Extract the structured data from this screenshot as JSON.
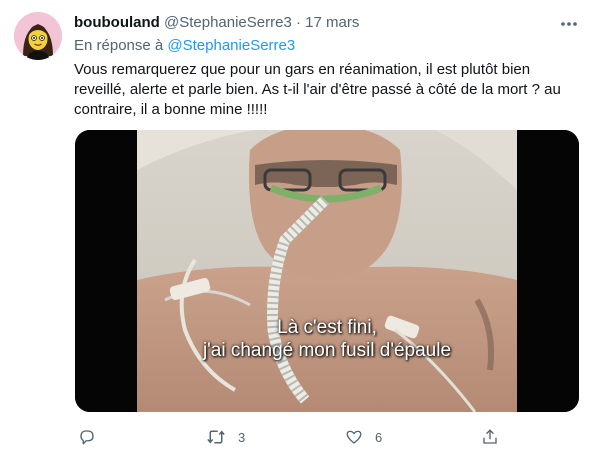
{
  "tweet": {
    "display_name": "boubouland",
    "handle": "@StephanieSerre3",
    "separator": "·",
    "date": "17 mars",
    "more_icon": "more-horizontal-icon",
    "reply_prefix": "En réponse à",
    "reply_handle": "@StephanieSerre3",
    "text_lines": [
      "Vous remarquerez que pour un gars en réanimation, il est plutôt bien",
      "reveillé, alerte et parle bien. As t-il l'air d'être passé à côté de la mort ? au",
      "contraire, il a bonne mine !!!!!"
    ]
  },
  "media": {
    "subtitle_lines": [
      "Là c'est fini,",
      "j'ai changé mon fusil d'épaule"
    ]
  },
  "actions": {
    "reply_icon": "reply-icon",
    "retweet_icon": "retweet-icon",
    "retweet_count": "3",
    "like_icon": "like-icon",
    "like_count": "6",
    "share_icon": "share-icon"
  }
}
